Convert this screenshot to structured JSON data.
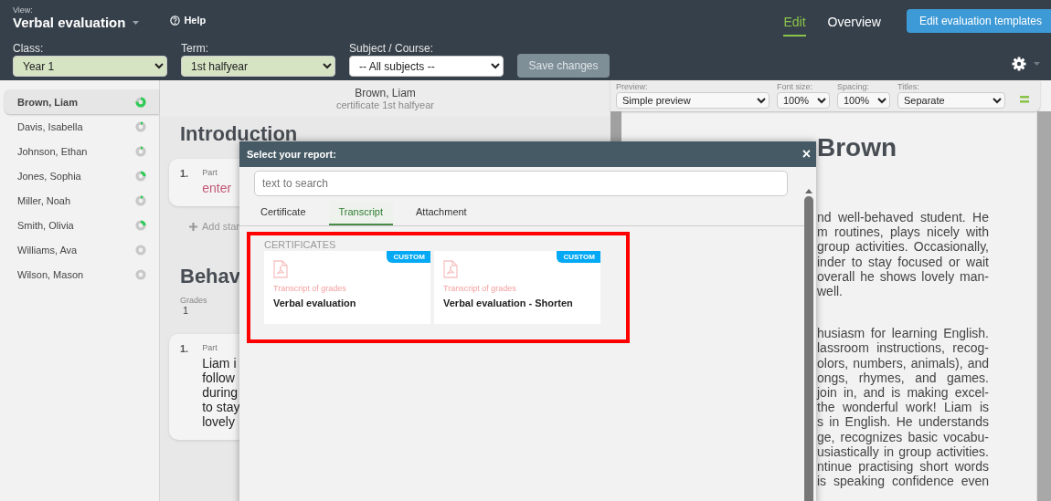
{
  "header": {
    "view_label": "View:",
    "view_title": "Verbal evaluation",
    "help": "Help",
    "tabs": [
      {
        "label": "Edit",
        "selected": true
      },
      {
        "label": "Overview",
        "selected": false
      }
    ],
    "templates_button": "Edit evaluation templates"
  },
  "filters": [
    {
      "label": "Class:",
      "value": "Year 1",
      "highlighted": true
    },
    {
      "label": "Term:",
      "value": "1st halfyear",
      "highlighted": true
    },
    {
      "label": "Subject / Course:",
      "value": "-- All subjects --",
      "highlighted": false
    }
  ],
  "save_button": {
    "label": "Save changes",
    "disabled": true
  },
  "students": [
    {
      "name": "Brown, Liam",
      "selected": true,
      "level": 0.75
    },
    {
      "name": "Davis, Isabella",
      "selected": false,
      "level": 0.08
    },
    {
      "name": "Johnson, Ethan",
      "selected": false,
      "level": 0.08
    },
    {
      "name": "Jones, Sophia",
      "selected": false,
      "level": 0.25
    },
    {
      "name": "Miller, Noah",
      "selected": false,
      "level": 0.08
    },
    {
      "name": "Smith, Olivia",
      "selected": false,
      "level": 0.25
    },
    {
      "name": "Williams, Ava",
      "selected": false,
      "level": 0
    },
    {
      "name": "Wilson, Mason",
      "selected": false,
      "level": 0
    }
  ],
  "editor": {
    "student": "Brown, Liam",
    "subtitle": "certificate 1st halfyear",
    "sections": [
      {
        "title": "Introduction",
        "parts": [
          {
            "number": "1.",
            "label": "Part",
            "kind": "placeholder",
            "lines": [
              "enter"
            ]
          }
        ],
        "add_link": "Add stan"
      },
      {
        "title": "Behav",
        "grades": {
          "label": "Grades",
          "value": "1"
        },
        "parts": [
          {
            "number": "1.",
            "label": "Part",
            "kind": "text",
            "lines": [
              "Liam i",
              "follow",
              "during",
              "to stay",
              "lovely"
            ]
          }
        ]
      }
    ]
  },
  "preview_toolbar": [
    {
      "label": "Preview:",
      "value": "Simple preview"
    },
    {
      "label": "Font size:",
      "value": "100%"
    },
    {
      "label": "Spacing:",
      "value": "100%"
    },
    {
      "label": "Titles:",
      "value": "Separate"
    }
  ],
  "document": {
    "heading": "Brown",
    "paragraphs": [
      {
        "lines": [
          "nd well-behaved student. He",
          "m routines, plays nicely with",
          "group activities. Occasionally,",
          "inder to stay focused or wait",
          "overall he shows lovely man-",
          "well."
        ]
      },
      {
        "lines": [
          "husiasm for learning English.",
          "lassroom instructions, recog-",
          "olors, numbers, animals), and",
          "ongs, rhymes, and games.",
          "join in, and is making excel-",
          "the wonderful work! Liam is",
          "s in English. He understands",
          "ge, recognizes basic vocabu-",
          "usiastically in group activities.",
          "ntinue practising short words",
          "is speaking confidence even"
        ]
      }
    ]
  },
  "modal": {
    "title": "Select your report:",
    "close": "×",
    "search_placeholder": "text to search",
    "tabs": [
      {
        "label": "Certificate",
        "selected": false
      },
      {
        "label": "Transcript",
        "selected": true
      },
      {
        "label": "Attachment",
        "selected": false
      }
    ],
    "section": "CERTIFICATES",
    "highlighted": true,
    "reports": [
      {
        "badge": "CUSTOM",
        "category": "Transcript of grades",
        "title": "Verbal evaluation"
      },
      {
        "badge": "CUSTOM",
        "category": "Transcript of grades",
        "title": "Verbal evaluation - Shorten"
      }
    ]
  }
}
